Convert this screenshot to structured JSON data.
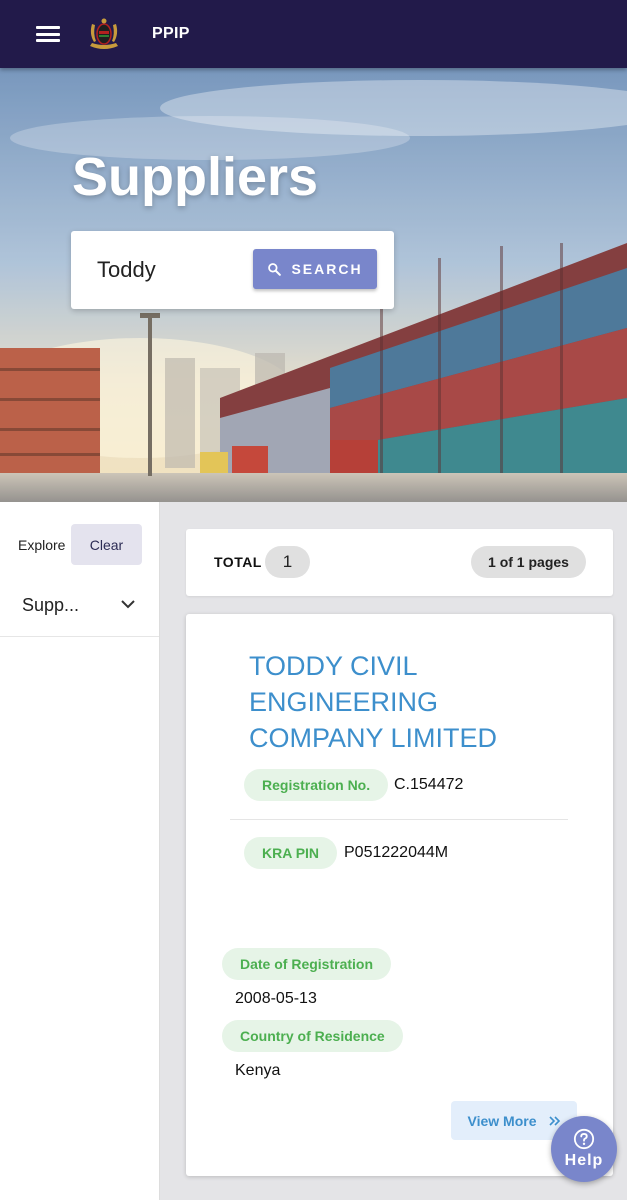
{
  "app": {
    "title": "PPIP",
    "menu_icon": "hamburger-menu-icon",
    "logo_icon": "kenya-coat-of-arms-icon"
  },
  "hero": {
    "title": "Suppliers",
    "search": {
      "value": "Toddy",
      "button_label": "SEARCH",
      "button_icon": "search-icon"
    }
  },
  "sidebar": {
    "explore_label": "Explore",
    "clear_label": "Clear",
    "filter_value": "Supp...",
    "filter_icon": "chevron-down-icon"
  },
  "results": {
    "total_label": "TOTAL",
    "total_count": "1",
    "pages": "1 of 1 pages"
  },
  "supplier": {
    "name": "TODDY CIVIL ENGINEERING COMPANY LIMITED",
    "registration_label": "Registration No.",
    "registration_value": "C.154472",
    "kra_label": "KRA PIN",
    "kra_value": "P051222044M",
    "date_label": "Date of Registration",
    "date_value": "2008-05-13",
    "country_label": "Country of Residence",
    "country_value": "Kenya",
    "view_more_label": "View More",
    "view_more_icon": "double-chevron-right-icon"
  },
  "help": {
    "label": "Help",
    "icon": "question-circle-icon"
  },
  "colors": {
    "appbar": "#221a4a",
    "accent": "#7986cb",
    "link": "#3d8fcc",
    "chip_green_bg": "#e6f4e7",
    "chip_green_text": "#4caf50"
  }
}
